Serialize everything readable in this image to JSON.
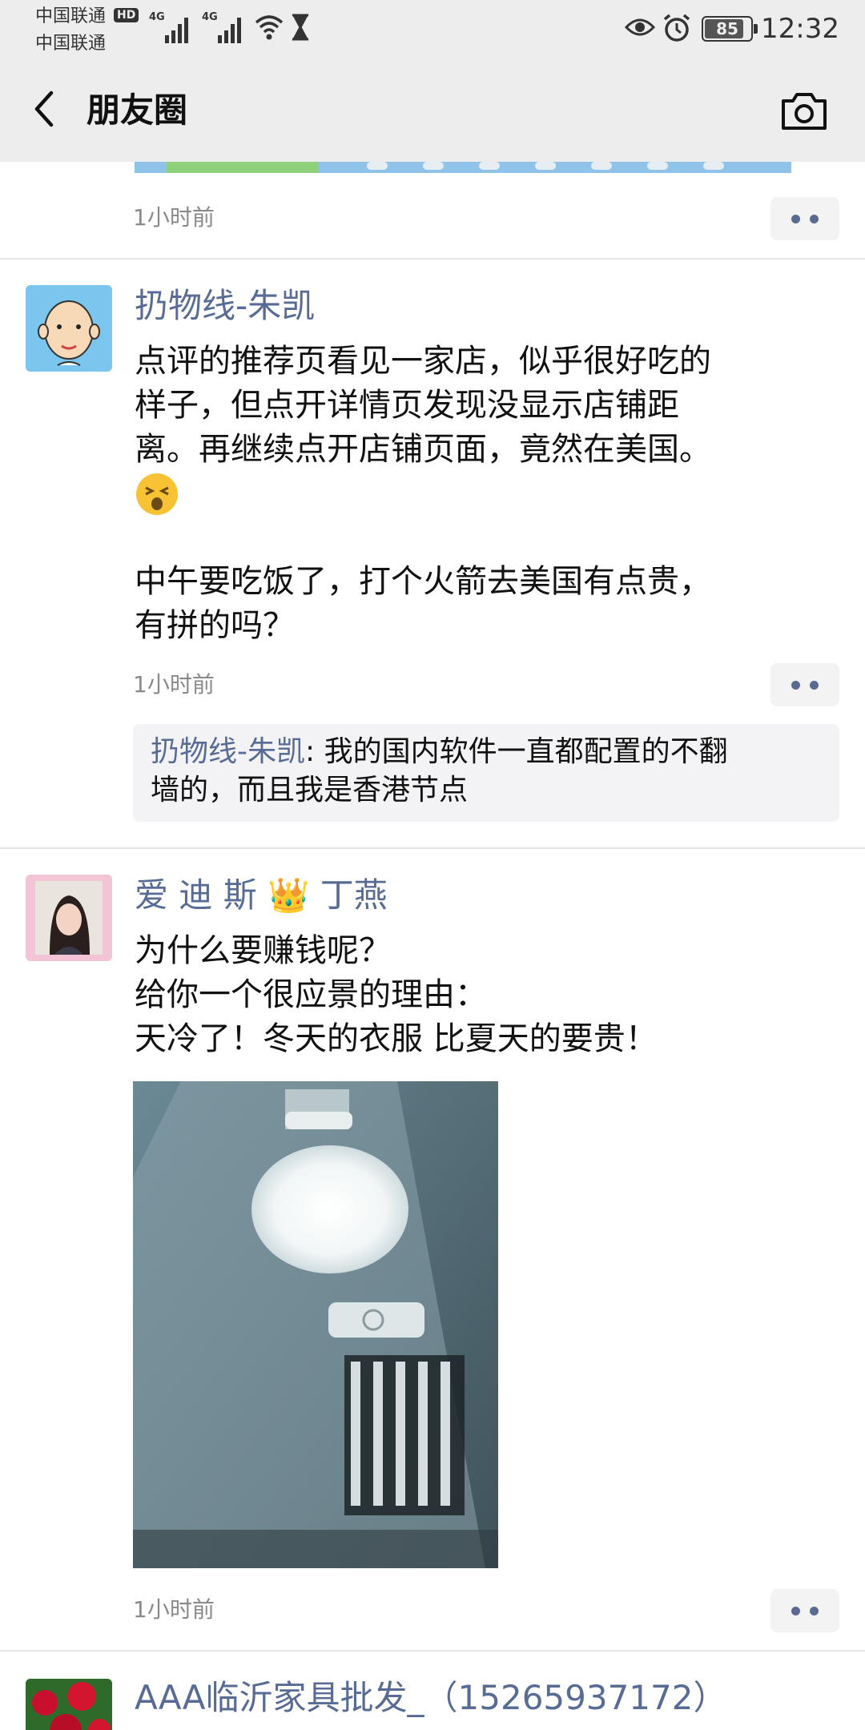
{
  "status_bar": {
    "carrier_1": "中国联通",
    "carrier_2": "中国联通",
    "hd_badge": "HD",
    "network_1": "4G",
    "network_2": "4G",
    "battery": "85",
    "time": "12:32",
    "icons": [
      "signal-icon",
      "wifi-icon",
      "hourglass-icon",
      "eye-icon",
      "alarm-icon",
      "battery-icon"
    ]
  },
  "nav": {
    "back_icon": "chevron-left-icon",
    "title": "朋友圈",
    "camera_icon": "camera-icon"
  },
  "feed": {
    "previous_post": {
      "time": "1小时前"
    },
    "posts": [
      {
        "author": "扔物线-朱凯",
        "lines": [
          "点评的推荐页看见一家店，似乎很好吃的",
          "样子，但点开详情页发现没显示店铺距",
          "离。再继续点开店铺页面，竟然在美国。",
          "",
          "中午要吃饭了，打个火箭去美国有点贵，",
          "有拼的吗？"
        ],
        "emoji": "dizzy-face-emoji",
        "time": "1小时前",
        "comment": {
          "author": "扔物线-朱凯",
          "separator": ": ",
          "text_line_1": "我的国内软件一直都配置的不翻",
          "text_line_2": "墙的，而且我是香港节点"
        }
      },
      {
        "author_part_1": "爱 迪 斯",
        "author_crown": "👑",
        "author_part_2": "丁燕",
        "lines": [
          "为什么要赚钱呢？",
          "给你一个很应景的理由：",
          "天冷了！冬天的衣服 比夏天的要贵！"
        ],
        "image": "street-lamp-photo",
        "time": "1小时前"
      },
      {
        "author": "AAA临沂家具批发_（15265937172）"
      }
    ]
  }
}
